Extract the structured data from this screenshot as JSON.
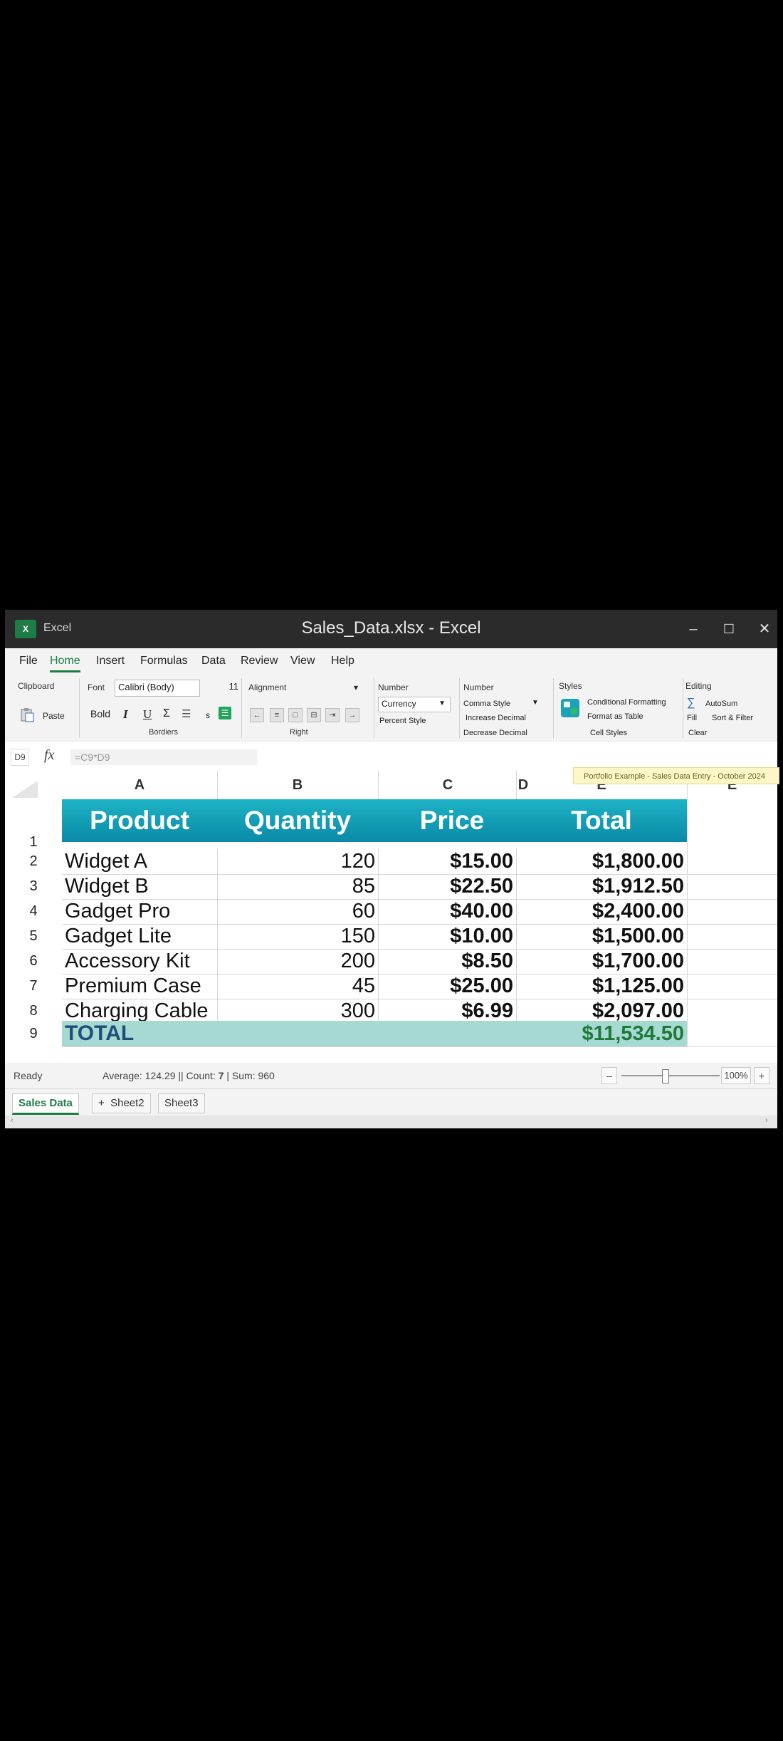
{
  "window": {
    "app_name": "Excel",
    "title": "Sales_Data.xlsx - Excel",
    "app_icon": "X",
    "controls": {
      "minimize": "–",
      "maximize": "☐",
      "close": "✕"
    }
  },
  "menu": [
    "File",
    "Home",
    "Insert",
    "Formulas",
    "Data",
    "Review",
    "View",
    "Help"
  ],
  "ribbon": {
    "clipboard_label": "Clipboard",
    "paste": "Paste",
    "font_label": "Font",
    "font_name": "Calibri (Body)",
    "font_size": "11",
    "bold": "Bold",
    "italic": "I",
    "underline": "U",
    "sigma": "Σ",
    "s": "s",
    "borders": "Bordiers",
    "alignment_label": "Alignment",
    "alignment_caret": "▾",
    "right": "Right",
    "number_label_1": "Number",
    "number_format": "Currency",
    "percent_style": "Percent Style",
    "number_label_2": "Number",
    "comma_style": "Comma Style",
    "increase_decimal": "Increase Decimal",
    "decrease_decimal": "Decrease Decimal",
    "styles_label": "Styles",
    "conditional_formatting": "Conditional Formatting",
    "format_as_table": "Format as Table",
    "cell_styles": "Cell Styles",
    "editing_label": "Editing",
    "autosum": "AutoSum",
    "fill": "Fill",
    "sort_filter": "Sort & Filter",
    "clear": "Clear"
  },
  "formula_bar": {
    "name_box": "D9",
    "fx": "fx",
    "formula": "=C9*D9"
  },
  "note": "Portfolio Example - Sales Data Entry - October 2024",
  "columns": [
    "A",
    "B",
    "C",
    "D",
    "E",
    "E"
  ],
  "table": {
    "headers": [
      "Product",
      "Quantity",
      "Price",
      "Total"
    ],
    "rows": [
      {
        "num": "2",
        "product": "Widget A",
        "qty": "120",
        "price": "$15.00",
        "total": "$1,800.00"
      },
      {
        "num": "3",
        "product": "Widget B",
        "qty": "85",
        "price": "$22.50",
        "total": "$1,912.50"
      },
      {
        "num": "4",
        "product": "Gadget Pro",
        "qty": "60",
        "price": "$40.00",
        "total": "$2,400.00"
      },
      {
        "num": "5",
        "product": "Gadget Lite",
        "qty": "150",
        "price": "$10.00",
        "total": "$1,500.00"
      },
      {
        "num": "6",
        "product": "Accessory Kit",
        "qty": "200",
        "price": "$8.50",
        "total": "$1,700.00"
      },
      {
        "num": "7",
        "product": "Premium Case",
        "qty": "45",
        "price": "$25.00",
        "total": "$1,125.00"
      },
      {
        "num": "8",
        "product": "Charging Cable",
        "qty": "300",
        "price": "$6.99",
        "total": "$2,097.00"
      }
    ],
    "total_row": {
      "num": "9",
      "label": "TOTAL",
      "value": "$11,534.50"
    },
    "header_row_num": "1"
  },
  "status": {
    "ready": "Ready",
    "summary_prefix": "Average: 124.29 || Count:",
    "count": "7",
    "summary_suffix": "| Sum: 960",
    "zoom": "100%",
    "zoom_minus": "–",
    "zoom_plus": "+"
  },
  "sheets": {
    "active": "Sales Data",
    "add": "+",
    "others": [
      "Sheet2",
      "Sheet3"
    ]
  },
  "colors": {
    "accent": "#1d7d45",
    "header_fill": "#0b9ab6",
    "total_fill": "#a7d9d3",
    "total_text_label": "#1d4f7a",
    "total_text_value": "#1f7a3a"
  }
}
